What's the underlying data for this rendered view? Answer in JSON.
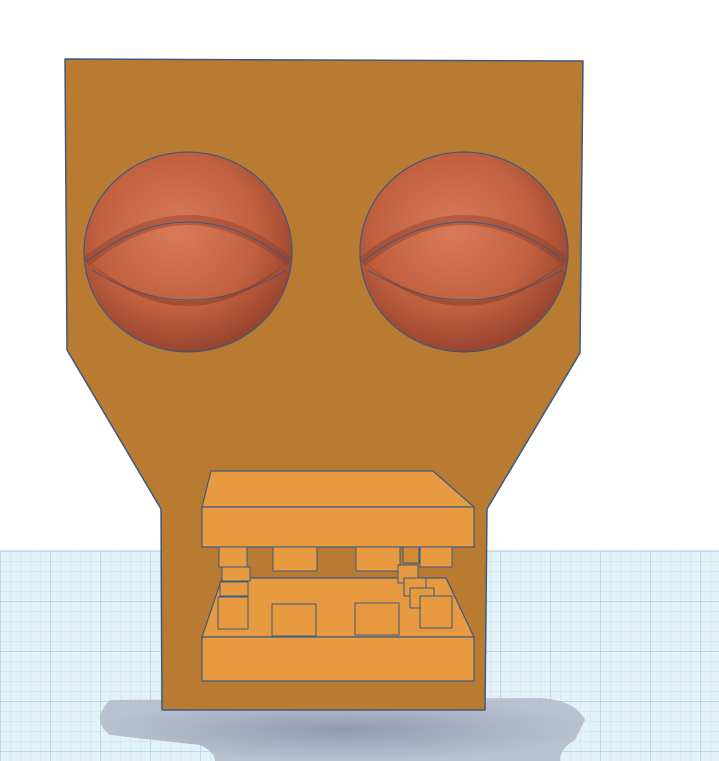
{
  "viewport": {
    "background": "#ffffff",
    "workplane_color": "#cfe6f0",
    "workplane_grid_color": "#9ecbe0",
    "shadow_color": "#9aa3b6"
  },
  "model": {
    "face_color": "#b97a32",
    "outline_color": "#3d5a80",
    "eye_color": "#c96a4a",
    "eye_dark_color": "#8f3e2c",
    "mouth_color": "#e89a40",
    "mouth_side_color": "#c97f2e"
  }
}
